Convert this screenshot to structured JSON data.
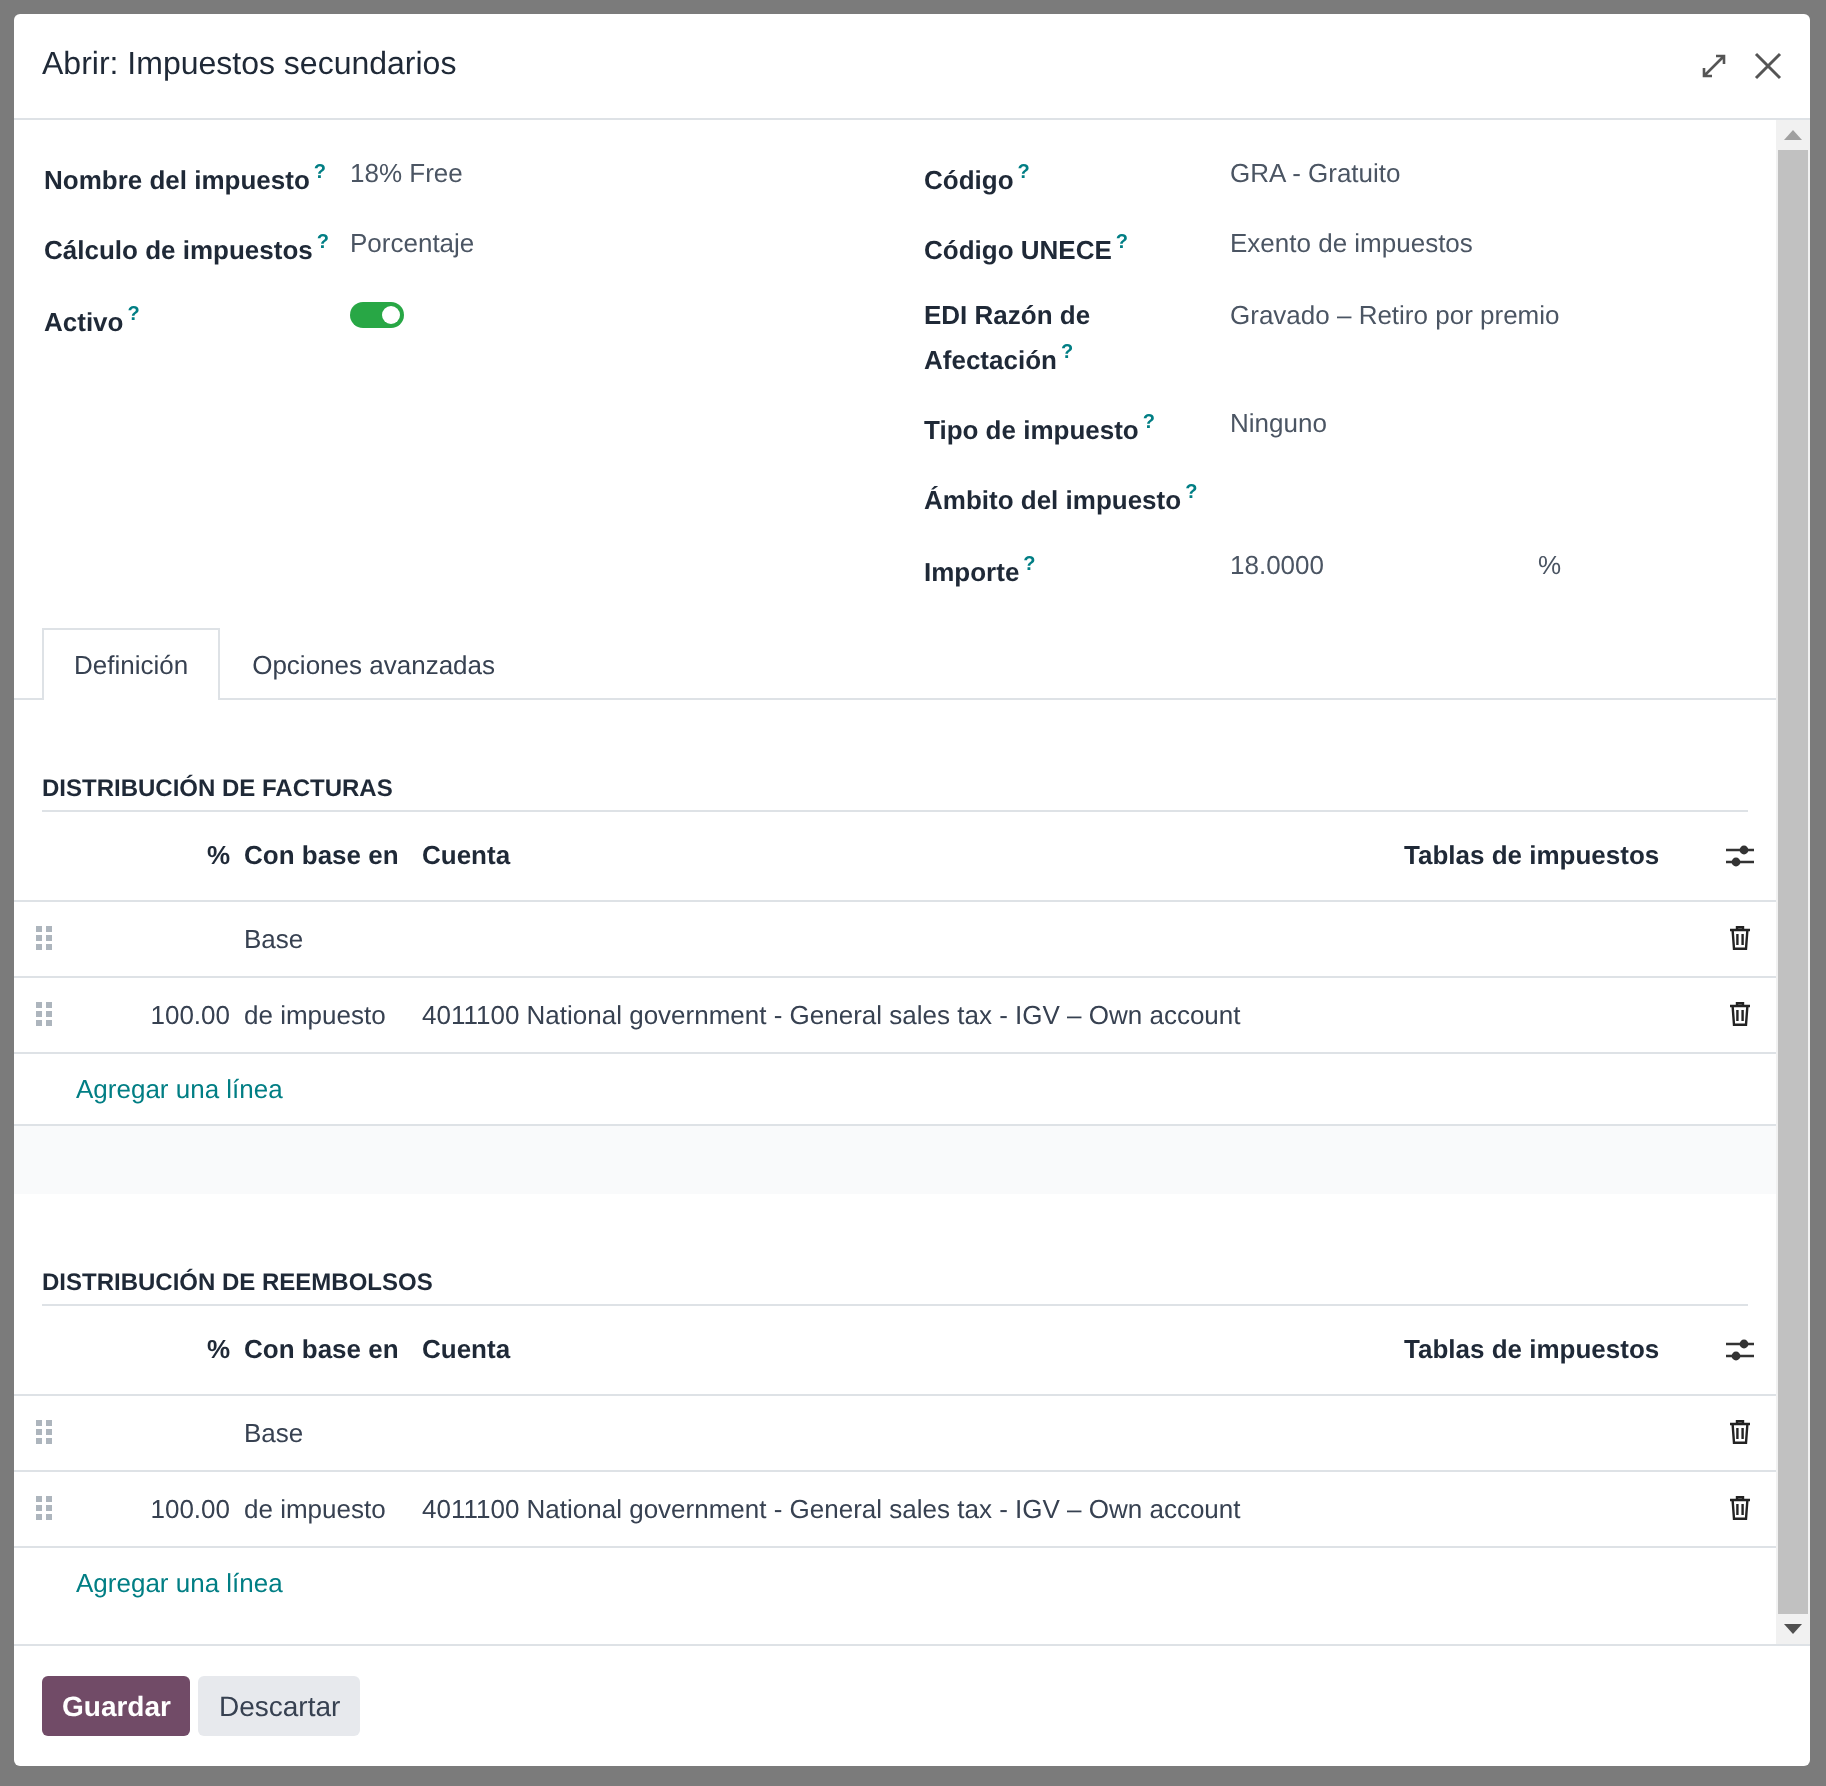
{
  "dialog": {
    "title": "Abrir: Impuestos secundarios"
  },
  "left_fields": [
    {
      "label": "Nombre del impuesto",
      "help": "?",
      "kind": "text",
      "value": "18% Free"
    },
    {
      "label": "Cálculo de impuestos",
      "help": "?",
      "kind": "text",
      "value": "Porcentaje"
    },
    {
      "label": "Activo",
      "help": "?",
      "kind": "toggle",
      "on": true
    }
  ],
  "right_fields": [
    {
      "label": "Código",
      "help": "?",
      "kind": "text",
      "value": "GRA - Gratuito"
    },
    {
      "label": "Código UNECE",
      "help": "?",
      "kind": "text",
      "value": "Exento de impuestos"
    },
    {
      "label": "EDI Razón de Afectación",
      "help": "?",
      "kind": "text",
      "value": "Gravado – Retiro por premio"
    },
    {
      "label": "Tipo de impuesto",
      "help": "?",
      "kind": "text",
      "value": "Ninguno"
    },
    {
      "label": "Ámbito del impuesto",
      "help": "?",
      "kind": "text"
    },
    {
      "label": "Importe",
      "help": "?",
      "kind": "amount",
      "value": "18.0000",
      "suffix": "%"
    }
  ],
  "tabs": [
    {
      "label": "Definición",
      "selected": true
    },
    {
      "label": "Opciones avanzadas",
      "selected": false
    }
  ],
  "sections": [
    {
      "title": "DISTRIBUCIÓN DE FACTURAS",
      "columns": {
        "percent": "%",
        "based_on": "Con base en",
        "account": "Cuenta",
        "tax_grids": "Tablas de impuestos"
      },
      "rows": [
        {
          "based_on": "Base"
        },
        {
          "percent": "100.00",
          "based_on": "de impuesto",
          "account": "4011100 National government - General sales tax - IGV – Own account"
        }
      ],
      "add_line": "Agregar una línea"
    },
    {
      "title": "DISTRIBUCIÓN DE REEMBOLSOS",
      "columns": {
        "percent": "%",
        "based_on": "Con base en",
        "account": "Cuenta",
        "tax_grids": "Tablas de impuestos"
      },
      "rows": [
        {
          "based_on": "Base"
        },
        {
          "percent": "100.00",
          "based_on": "de impuesto",
          "account": "4011100 National government - General sales tax - IGV – Own account"
        }
      ],
      "add_line": "Agregar una línea"
    }
  ],
  "buttons": [
    {
      "label": "Guardar",
      "kind": "primary"
    },
    {
      "label": "Descartar",
      "kind": "secondary"
    }
  ]
}
